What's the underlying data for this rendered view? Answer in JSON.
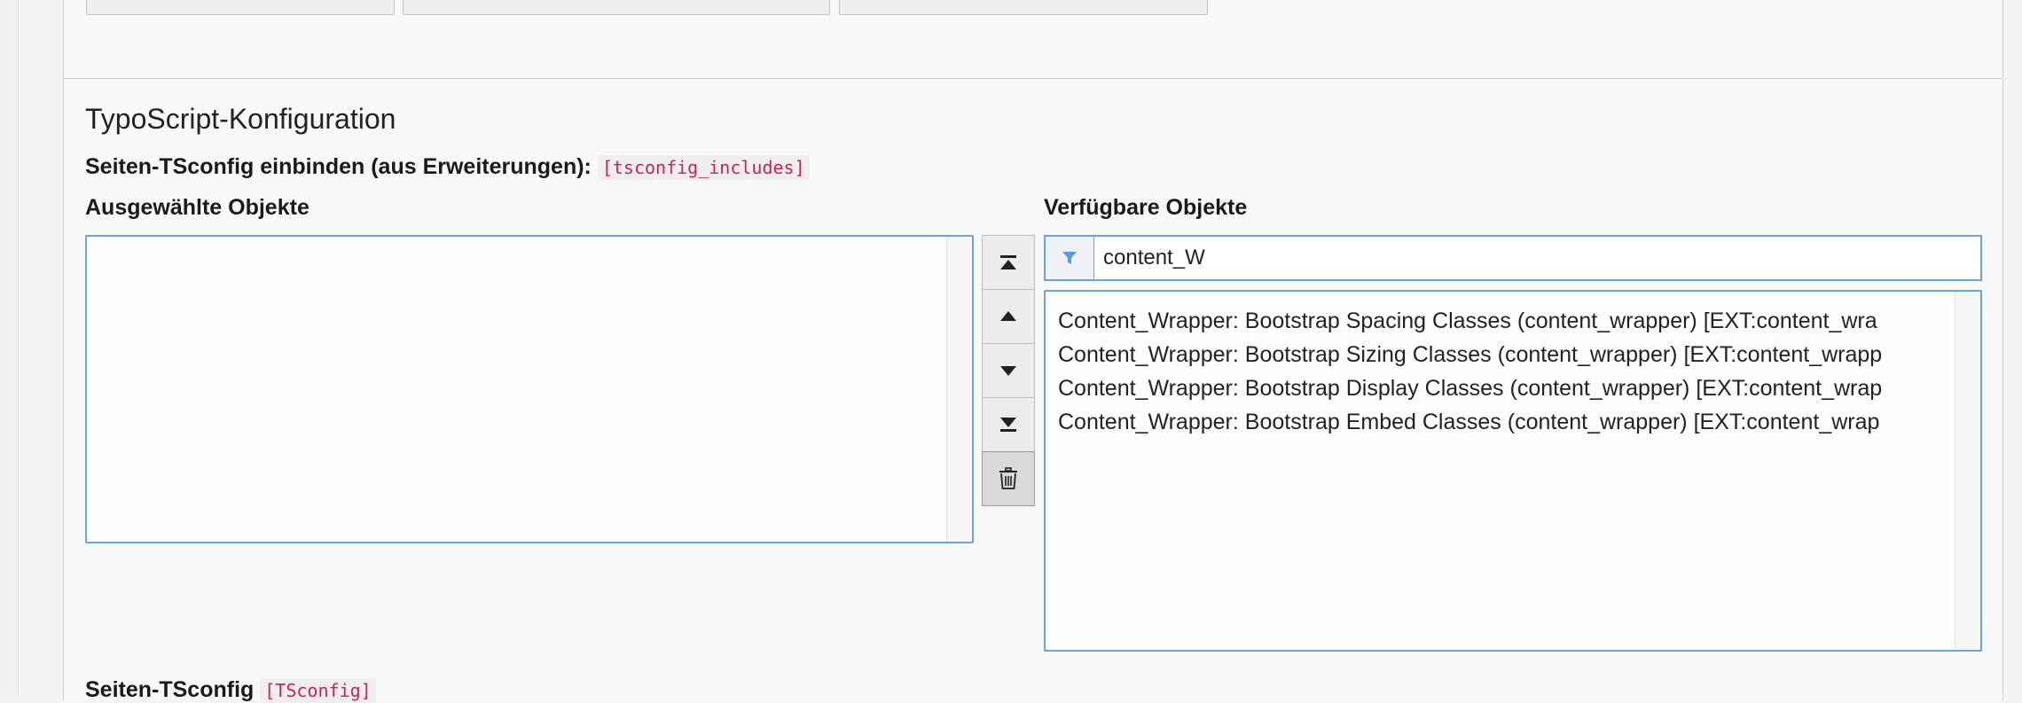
{
  "section": {
    "title": "TypoScript-Konfiguration"
  },
  "field": {
    "label": "Seiten-TSconfig einbinden (aus Erweiterungen):",
    "key": "[tsconfig_includes]"
  },
  "selected": {
    "label": "Ausgewählte Objekte",
    "items": []
  },
  "available": {
    "label": "Verfügbare Objekte",
    "filter_value": "content_W",
    "items": [
      "Content_Wrapper: Bootstrap Spacing Classes (content_wrapper) [EXT:content_wra",
      "Content_Wrapper: Bootstrap Sizing Classes (content_wrapper) [EXT:content_wrapp",
      "Content_Wrapper: Bootstrap Display Classes (content_wrapper) [EXT:content_wrap",
      "Content_Wrapper: Bootstrap Embed Classes (content_wrapper) [EXT:content_wrap"
    ]
  },
  "controls": [
    {
      "name": "move-to-top-icon"
    },
    {
      "name": "move-up-icon"
    },
    {
      "name": "move-down-icon"
    },
    {
      "name": "move-to-bottom-icon"
    },
    {
      "name": "trash-icon"
    }
  ],
  "next_field": {
    "label": "Seiten-TSconfig",
    "key": "[TSconfig]"
  },
  "colors": {
    "accent_border": "#6da3d6",
    "code_red": "#c7254e"
  }
}
